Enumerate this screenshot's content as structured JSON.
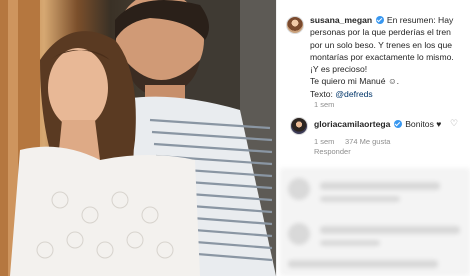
{
  "photo": {
    "description_icon": "couple-photo"
  },
  "post": {
    "author": "susana_megan",
    "caption": "En resumen: Hay personas por la que perderías el tren por un solo beso. Y trenes en los que montarías por exactamente lo mismo. ¡Y es precioso!",
    "love_line": "Te quiero mi Manué ☺.",
    "credit_label": "Texto: ",
    "credit_mention": "@defreds",
    "time": "1 sem"
  },
  "comment": {
    "author": "gloriacamilaortega",
    "text": "Bonitos ♥",
    "time": "1 sem",
    "likes": "374 Me gusta",
    "reply": "Responder"
  },
  "colors": {
    "verified": "#3897f0",
    "meta": "#8e8e8e",
    "text": "#262626"
  }
}
